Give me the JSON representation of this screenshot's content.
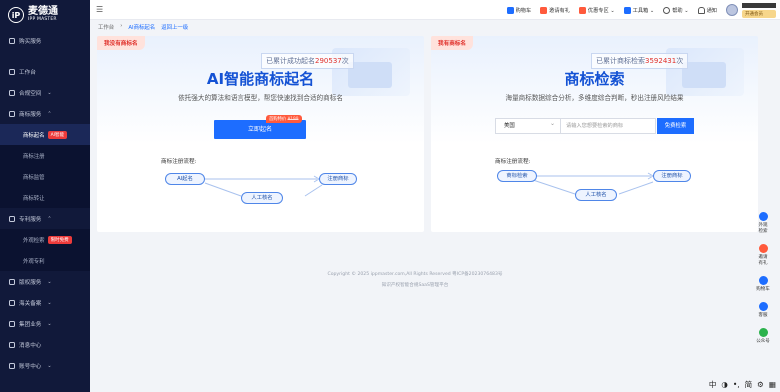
{
  "brand": {
    "logo_mark": "iP",
    "name_cn": "麦德通",
    "name_en": "IPP MASTER"
  },
  "sidebar": {
    "items": [
      {
        "label": "购买服务",
        "icon": "cart-icon"
      },
      {
        "label": "工作台",
        "icon": "desktop-icon"
      },
      {
        "label": "合规空间",
        "icon": "folder-icon",
        "caret": "⌄"
      },
      {
        "label": "商标服务",
        "icon": "trademark-icon",
        "caret": "⌃"
      }
    ],
    "trademark_sub": [
      {
        "label": "商标起名",
        "badge": "AI智能",
        "active": true
      },
      {
        "label": "商标注册"
      },
      {
        "label": "商标监管"
      },
      {
        "label": "商标转让"
      }
    ],
    "patent": {
      "label": "专利服务",
      "icon": "patent-icon",
      "caret": "⌃"
    },
    "patent_sub": [
      {
        "label": "外观检索",
        "badge": "限时免费"
      },
      {
        "label": "外观专利"
      }
    ],
    "lower_items": [
      {
        "label": "版权服务",
        "icon": "copyright-icon",
        "caret": "⌄"
      },
      {
        "label": "海关备案",
        "icon": "customs-icon",
        "caret": "⌄"
      },
      {
        "label": "集团业务",
        "icon": "group-icon",
        "caret": "⌄"
      },
      {
        "label": "消息中心",
        "icon": "message-icon"
      },
      {
        "label": "账号中心",
        "icon": "account-icon",
        "caret": "⌄"
      }
    ]
  },
  "topbar": {
    "links": [
      {
        "label": "购物车",
        "icon": "cart-icon",
        "color": "#1d6dff"
      },
      {
        "label": "邀请有礼",
        "icon": "gift-icon",
        "color": "#ff5a3c"
      },
      {
        "label": "优惠专区 ⌄",
        "icon": "coupon-icon",
        "color": "#ff5a3c"
      },
      {
        "label": "工具箱 ⌄",
        "icon": "toolbox-icon",
        "color": "#1d6dff"
      },
      {
        "label": "帮助 ⌄",
        "icon": "help-icon",
        "color": "#555555"
      },
      {
        "label": "通知",
        "icon": "bell-icon",
        "color": "#555555"
      }
    ],
    "vip_label": "开通会员"
  },
  "breadcrumb": {
    "home": "工作台",
    "current": "AI商标起名",
    "back": "返回上一级"
  },
  "left_card": {
    "tag": "我没有商标名",
    "counter_prefix": "已累计成功起名",
    "counter_value": "290537",
    "counter_suffix": "次",
    "title": "AI智能商标起名",
    "desc": "依托强大的算法和语言模型，帮您快速找到合适的商标名",
    "button": "立即起名",
    "promo_price": "首购特价",
    "promo_old": "¥199",
    "flow_title": "商标注册流程:",
    "flow_nodes": [
      "AI起名",
      "人工核名",
      "注册商标"
    ]
  },
  "right_card": {
    "tag": "我有商标名",
    "counter_prefix": "已累计商标检索",
    "counter_value": "3592431",
    "counter_suffix": "次",
    "title": "商标检索",
    "desc": "海量商标数据综合分析，多维度综合判断，秒出注册风险结果",
    "country": "美国",
    "input_placeholder": "请输入您想要检索的商标",
    "search_button": "免费检索",
    "flow_title": "商标注册流程:",
    "flow_nodes": [
      "商标检索",
      "人工核名",
      "注册商标"
    ]
  },
  "footer": {
    "line1": "Copyright © 2025 ippmaster.com,All Rights Reserved 粤ICP备2023076483号",
    "line2": "知识产权智能合规SaaS管理平台"
  },
  "rail": [
    {
      "label": "外观\n检索",
      "icon": "design-search-icon",
      "color": "#1d6dff"
    },
    {
      "label": "邀请\n有礼",
      "icon": "gift-icon",
      "color": "#ff5a3c"
    },
    {
      "label": "购物车",
      "icon": "cart-icon",
      "color": "#1d6dff"
    },
    {
      "label": "客服",
      "icon": "service-icon",
      "color": "#1d6dff"
    },
    {
      "label": "公众号",
      "icon": "wechat-icon",
      "color": "#2bb24c"
    }
  ],
  "ime": [
    "中",
    "◑",
    "•,",
    "简",
    "⚙",
    "▦"
  ]
}
